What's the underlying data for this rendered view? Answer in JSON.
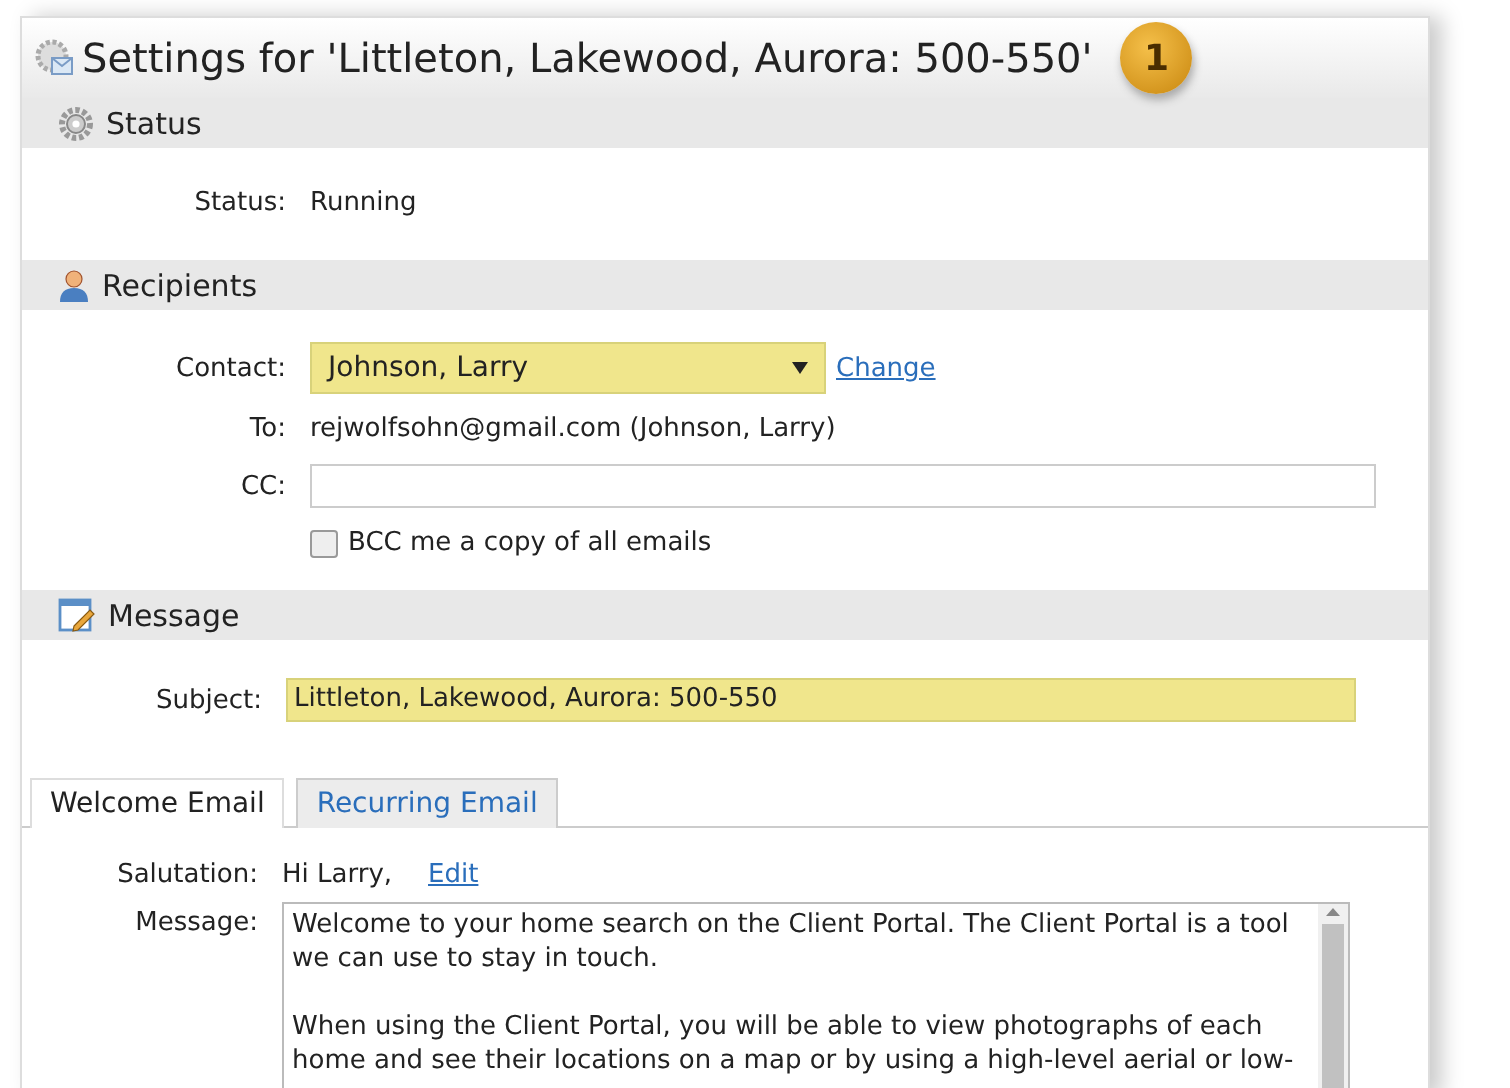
{
  "title": "Settings for 'Littleton, Lakewood, Aurora: 500-550'",
  "badge": "1",
  "status_section": {
    "heading": "Status",
    "label": "Status:",
    "value": "Running"
  },
  "recipients_section": {
    "heading": "Recipients",
    "contact": {
      "label": "Contact:",
      "value": "Johnson, Larry",
      "link": "Change"
    },
    "to": {
      "label": "To:",
      "value": "rejwolfsohn@gmail.com (Johnson, Larry)"
    },
    "cc": {
      "label": "CC:"
    },
    "bcc": {
      "label": "BCC me a copy of all emails",
      "checked": false
    }
  },
  "message_section": {
    "heading": "Message",
    "subject": {
      "label": "Subject:",
      "value": "Littleton, Lakewood, Aurora: 500-550"
    }
  },
  "tabs": [
    {
      "label": "Welcome Email",
      "selected": true
    },
    {
      "label": "Recurring Email",
      "selected": false
    }
  ],
  "salutation": {
    "label": "Salutation:",
    "value": "Hi Larry,",
    "link": "Edit"
  },
  "message": {
    "label": "Message:",
    "paragraphs": [
      "Welcome to your home search on the Client Portal. The Client Portal is a tool we can use to stay in touch.",
      "When using the Client Portal, you will be able to view photographs of each home and see their locations on a map or by using a high-level aerial or low-"
    ]
  }
}
